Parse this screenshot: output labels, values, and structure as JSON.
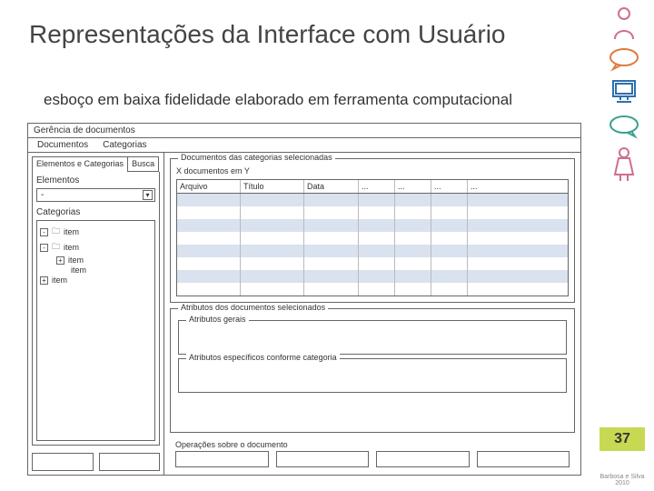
{
  "slide": {
    "title": "Representações da Interface com Usuário",
    "subtitle": "esboço em baixa fidelidade elaborado em ferramenta computacional",
    "page_number": "37",
    "credit": "Barbosa e Silva 2010"
  },
  "mockup": {
    "window_title": "Gerência de documentos",
    "menu": [
      "Documentos",
      "Categorias"
    ],
    "tabs": {
      "active": "Elementos e Categorias",
      "other": "Busca"
    },
    "left": {
      "section_elements": "Elementos",
      "combo_value": "-",
      "section_categories": "Categorias",
      "tree": [
        "item",
        "item",
        "item",
        "item",
        "item"
      ]
    },
    "right": {
      "docs_group": "Documentos das categorias selecionadas",
      "count": "X documentos em Y",
      "columns": [
        "Arquivo",
        "Título",
        "Data",
        "...",
        "...",
        "...",
        "..."
      ],
      "attr_group": "Atributos dos documentos selecionados",
      "attr_sub1": "Atributos gerais",
      "attr_sub2": "Atributos específicos conforme categoria",
      "ops_label": "Operações sobre o documento"
    }
  }
}
